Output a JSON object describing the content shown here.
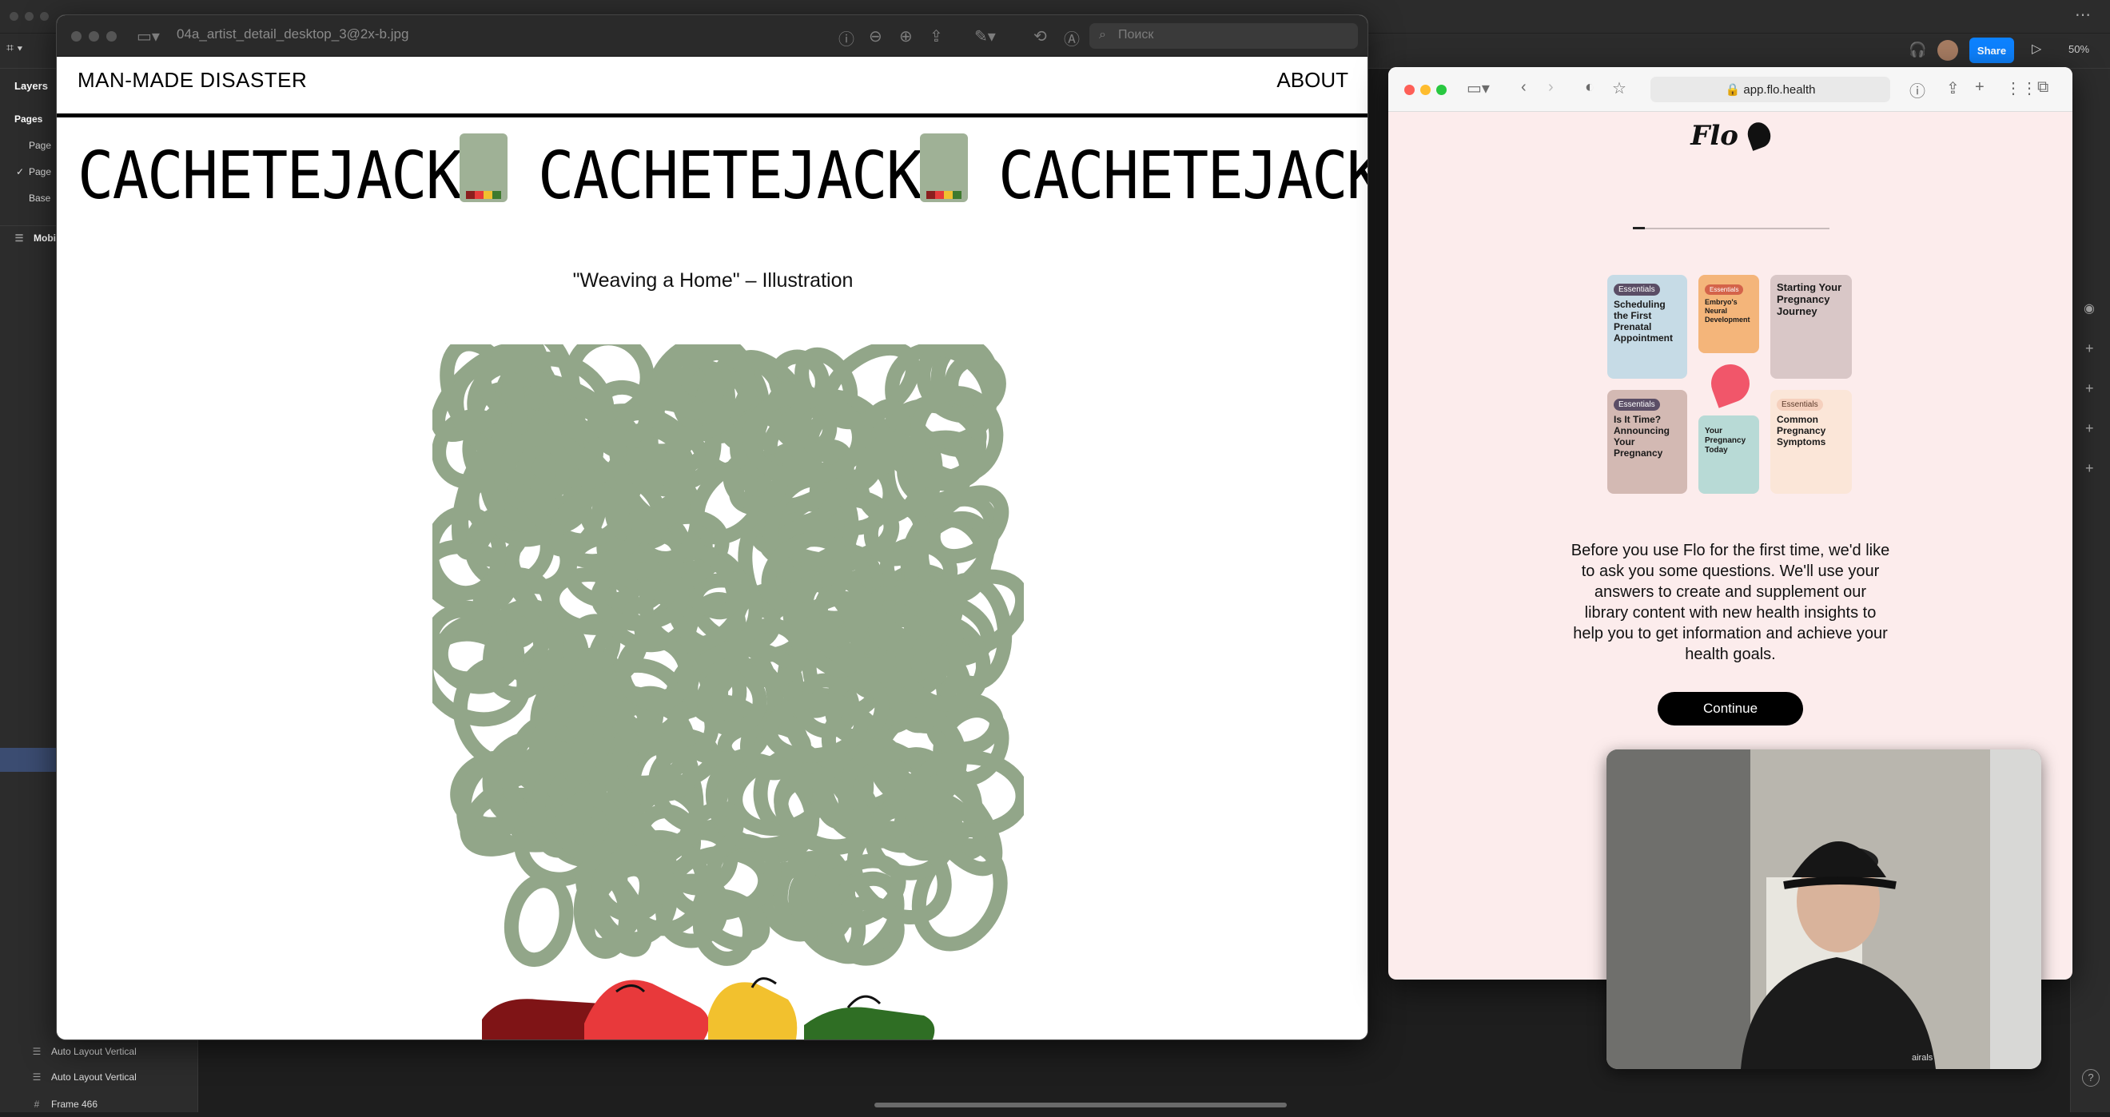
{
  "figma": {
    "panel_tabs": {
      "layers": "Layers"
    },
    "pages_heading": "Pages",
    "pages": [
      {
        "label": "Page",
        "selected": false
      },
      {
        "label": "Page",
        "selected": true
      },
      {
        "label": "Base",
        "selected": false
      }
    ],
    "top_frame": "Mobil",
    "layers": [
      {
        "label": "Auto Layout Vertical"
      },
      {
        "label": "Auto Layout Vertical"
      },
      {
        "label": "Frame 466"
      }
    ],
    "share_label": "Share",
    "zoom_label": "50%"
  },
  "preview": {
    "filename": "04a_artist_detail_desktop_3@2x-b.jpg",
    "search_placeholder": "Поиск",
    "site": {
      "brand": "MAN-MADE DISASTER",
      "nav_about": "ABOUT",
      "marquee_word": "CACHETEJACK",
      "artwork_title": "\"Weaving a Home\" – Illustration",
      "artwork_color": "#8da283"
    }
  },
  "safari": {
    "url": "app.flo.health",
    "flo": {
      "logo_text": "Flo",
      "progress_fraction": 0.06,
      "cards": [
        {
          "badge": "Essentials",
          "title": "Scheduling the First Prenatal Appointment",
          "bg": "#c6dbe6"
        },
        {
          "badge": "Essentials",
          "title": "Embryo's Neural Development",
          "bg": "#f4b57a"
        },
        {
          "badge": "",
          "title": "Starting Your Pregnancy Journey",
          "bg": "#d9c7c7"
        },
        {
          "badge": "Essentials",
          "title": "Is It Time? Announcing Your Pregnancy",
          "bg": "#d3b9b3"
        },
        {
          "badge": "",
          "title": "Your Pregnancy Today",
          "bg": "#b8dad6"
        },
        {
          "badge": "Essentials",
          "title": "Common Pregnancy Symptoms",
          "bg": "#fbe6d8"
        }
      ],
      "intro": "Before you use Flo for the first time, we'd like to ask you some questions. We'll use your answers to create and supplement our library content with new health insights to help you to get information and achieve your health goals.",
      "continue_label": "Continue"
    }
  },
  "webcam": {
    "hoodie_text": "airals"
  }
}
